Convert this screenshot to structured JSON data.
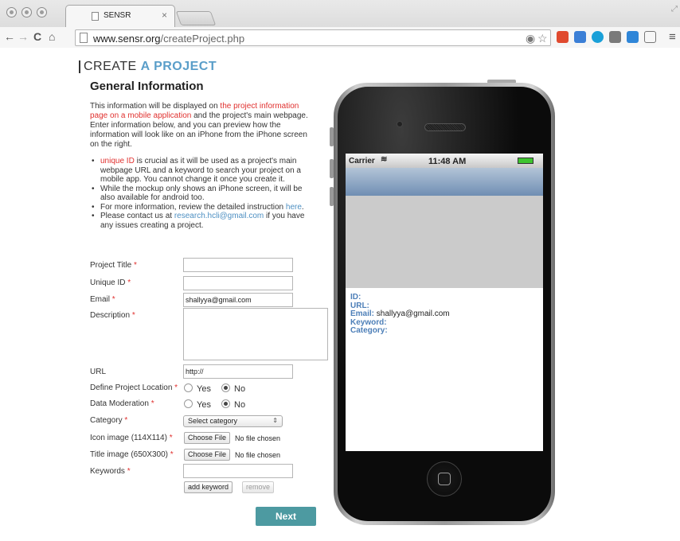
{
  "browser": {
    "tab_title": "SENSR",
    "tab_close": "×",
    "url_host": "www.sensr.org",
    "url_path": "/createProject.php",
    "back_glyph": "←",
    "forward_glyph": "→",
    "reload_glyph": "C",
    "home_glyph": "⌂",
    "star_glyph": "☆",
    "menu_glyph": "≡",
    "extension_colors": [
      "#e04a2f",
      "#3b7fd6",
      "#1aa0d8",
      "#7a7a7a",
      "#2f86d8"
    ]
  },
  "page": {
    "heading_prefix": "CREATE ",
    "heading_accent": "A PROJECT",
    "subheading": "General Information",
    "intro": {
      "t1": "This information will be displayed on ",
      "link1": "the project information page on a mobile application",
      "t2": " and the project's main webpage. Enter information below, and you can preview how the information will look like on an iPhone from the iPhone screen on the right."
    },
    "bullets": {
      "b1_link": "unique ID",
      "b1_text": " is crucial as it will be used as a project's main webpage URL and a keyword to search your project on a mobile app. You cannot change it once you create it.",
      "b2_text": "While the mockup only shows an iPhone screen, it will be also available for android too.",
      "b3_text": "For more information, review the detailed instruction ",
      "b3_link": "here",
      "b3_end": ".",
      "b4_text": "Please contact us at ",
      "b4_link": "research.hcli@gmail.com",
      "b4_end": " if you have any issues creating a project."
    },
    "required_marker": "*"
  },
  "form": {
    "project_title_label": "Project Title ",
    "project_title_value": "",
    "unique_id_label": "Unique ID ",
    "unique_id_value": "",
    "email_label": "Email ",
    "email_value": "shallyya@gmail.com",
    "description_label": "Description ",
    "url_label": "URL",
    "url_value": "http://",
    "location_label": "Define Project Location ",
    "moderation_label": "Data Moderation ",
    "yes_label": "Yes",
    "no_label": "No",
    "location_selected": "No",
    "moderation_selected": "No",
    "category_label": "Category ",
    "category_value": "Select category",
    "category_arrow": "⇕",
    "icon_label": "Icon image (114X114) ",
    "title_image_label": "Title image (650X300) ",
    "choose_file_label": "Choose File",
    "no_file_text": "No file chosen",
    "keywords_label": "Keywords ",
    "keywords_value": "",
    "add_keyword_label": "add keyword",
    "remove_label": "remove",
    "next_label": "Next"
  },
  "phone": {
    "carrier": "Carrier",
    "wifi_glyph": "≋",
    "time": "11:48 AM",
    "id_label": "ID:",
    "url_label": "URL:",
    "email_label": "Email:",
    "email_value": " shallyya@gmail.com",
    "keyword_label": "Keyword:",
    "category_label": "Category:"
  }
}
